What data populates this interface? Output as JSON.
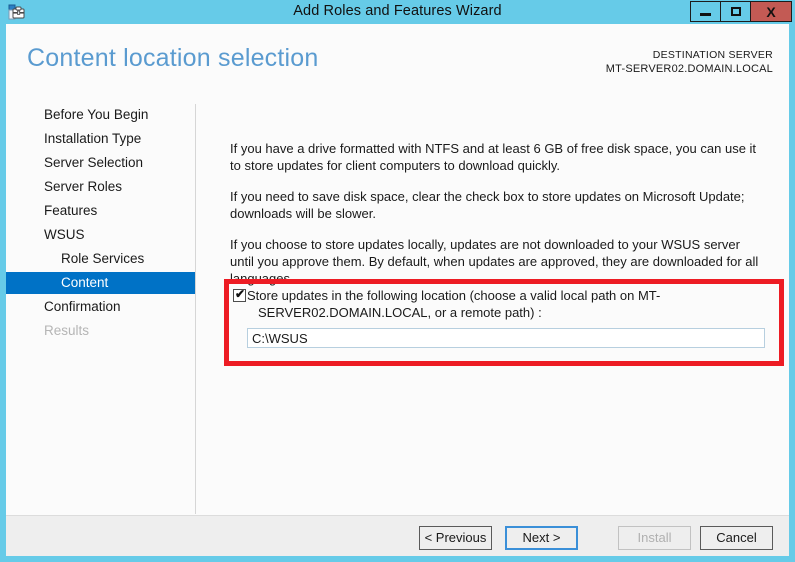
{
  "window": {
    "title": "Add Roles and Features Wizard",
    "icon": "wizard-server-icon",
    "controls": {
      "minimize": "minimize-icon",
      "maximize": "maximize-icon",
      "close": "X"
    },
    "accent_titlebar_color": "#66cbe8",
    "close_button_color": "#c35a54"
  },
  "header": {
    "page_title": "Content location selection",
    "destination_label": "DESTINATION SERVER",
    "destination_value": "MT-SERVER02.DOMAIN.LOCAL",
    "title_color": "#5a9bd0"
  },
  "sidebar": {
    "selected_color": "#0072c6",
    "items": [
      {
        "label": "Before You Begin",
        "state": "normal",
        "sub": false
      },
      {
        "label": "Installation Type",
        "state": "normal",
        "sub": false
      },
      {
        "label": "Server Selection",
        "state": "normal",
        "sub": false
      },
      {
        "label": "Server Roles",
        "state": "normal",
        "sub": false
      },
      {
        "label": "Features",
        "state": "normal",
        "sub": false
      },
      {
        "label": "WSUS",
        "state": "normal",
        "sub": false
      },
      {
        "label": "Role Services",
        "state": "normal",
        "sub": true
      },
      {
        "label": "Content",
        "state": "selected",
        "sub": true
      },
      {
        "label": "Confirmation",
        "state": "normal",
        "sub": false
      },
      {
        "label": "Results",
        "state": "disabled",
        "sub": false
      }
    ]
  },
  "main": {
    "paragraph_1": "If you have a drive formatted with NTFS and at least 6 GB of free disk space, you can use it to store updates for client computers to download quickly.",
    "paragraph_2": "If you need to save disk space, clear the check box to store updates on Microsoft Update; downloads will be slower.",
    "paragraph_3": "If you choose to store updates locally, updates are not downloaded to your WSUS server until you approve them. By default, when updates are approved, they are downloaded for all languages.",
    "checkbox": {
      "checked": true,
      "check_glyph": "✔",
      "label_line1": "Store updates in the following location (choose a valid local path on MT-",
      "label_line2": "SERVER02.DOMAIN.LOCAL, or a remote path) :"
    },
    "path_input": {
      "value": "C:\\WSUS",
      "placeholder": ""
    },
    "highlight_box_color": "#ed1c24"
  },
  "footer": {
    "previous_label": "< Previous",
    "next_label": "Next >",
    "install_label": "Install",
    "cancel_label": "Cancel",
    "install_disabled": true,
    "next_focused": true
  }
}
